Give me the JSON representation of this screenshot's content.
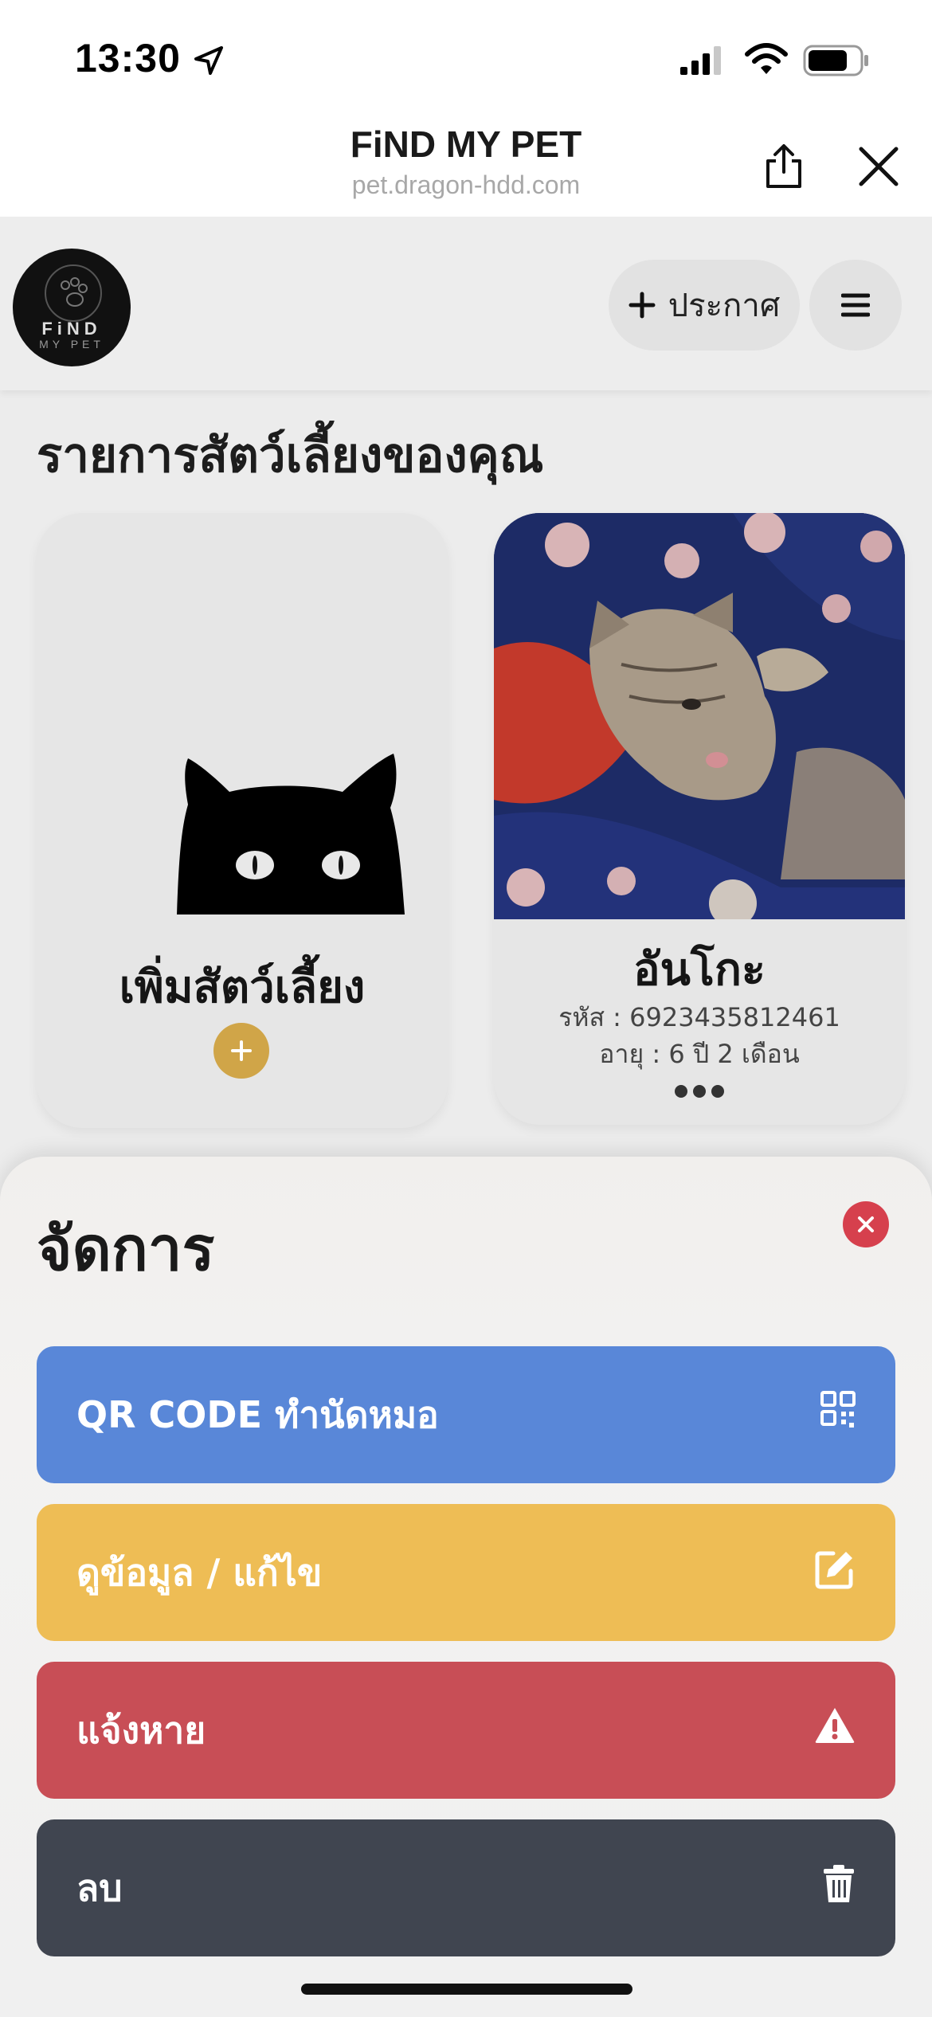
{
  "status_bar": {
    "time": "13:30"
  },
  "browser": {
    "title": "FiND MY PET",
    "url": "pet.dragon-hdd.com"
  },
  "nav": {
    "logo_text": "FiND",
    "logo_sub": "MY PET",
    "announce_label": "ประกาศ"
  },
  "pets": {
    "heading": "รายการสัตว์เลี้ยงของคุณ",
    "add_card_label": "เพิ่มสัตว์เลี้ยง",
    "items": [
      {
        "name": "อันโกะ",
        "code": "รหัส : 6923435812461",
        "age": "อายุ : 6 ปี 2 เดือน"
      }
    ]
  },
  "sheet": {
    "title": "จัดการ",
    "actions": [
      {
        "label": "QR CODE ทำนัดหมอ",
        "icon": "qrcode-icon",
        "color": "#5987d8"
      },
      {
        "label": "ดูข้อมูล / แก้ไข",
        "icon": "edit-icon",
        "color": "#eebd55"
      },
      {
        "label": "แจ้งหาย",
        "icon": "warning-icon",
        "color": "#c84e56"
      },
      {
        "label": "ลบ",
        "icon": "trash-icon",
        "color": "#404550"
      }
    ]
  }
}
